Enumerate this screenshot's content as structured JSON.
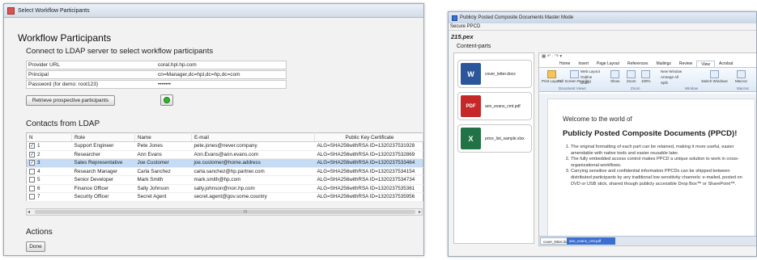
{
  "left_window": {
    "title": "Select Workflow Participants",
    "heading": "Workflow Participants",
    "ldap_subtitle": "Connect to LDAP server to select workflow participants",
    "fields": [
      {
        "label": "Provider URL",
        "value": "coral.hpl.hp.com"
      },
      {
        "label": "Principal",
        "value": "cn=Manager,dc=hpl,dc=hp,dc=com"
      },
      {
        "label": "Password (for demo: root123)",
        "value": "•••••••"
      }
    ],
    "retrieve_button": "Retrieve prospective participants",
    "contacts_heading": "Contacts from LDAP",
    "table": {
      "headers": [
        "N",
        "Role",
        "Name",
        "E-mail",
        "Public Key Certificate"
      ],
      "rows": [
        {
          "checked": true,
          "n": "1",
          "role": "Support Engineer",
          "name": "Pete Jones",
          "email": "pete.jones@never.company",
          "cert": "ALG=SHA256withRSA  ID=1320237531928"
        },
        {
          "checked": true,
          "n": "2",
          "role": "Researcher",
          "name": "Ann Evans",
          "email": "Ann.Evans@ann.evans.com",
          "cert": "ALG=SHA256withRSA  ID=1320237532869"
        },
        {
          "checked": true,
          "n": "3",
          "role": "Sales Representative",
          "name": "Joe Customer",
          "email": "joe.customer@home.address",
          "cert": "ALG=SHA256withRSA  ID=1320237533464",
          "selected": true
        },
        {
          "checked": false,
          "n": "4",
          "role": "Research Manager",
          "name": "Carla Sanchez",
          "email": "carla.sanchez@hp.partner.com",
          "cert": "ALG=SHA256withRSA  ID=1320237534154"
        },
        {
          "checked": false,
          "n": "5",
          "role": "Senior Developer",
          "name": "Mark Smith",
          "email": "mark.smith@hp.com",
          "cert": "ALG=SHA256withRSA  ID=1320237534734"
        },
        {
          "checked": false,
          "n": "6",
          "role": "Finance Officer",
          "name": "Sally Johnson",
          "email": "sally.johnson@non.hp.com",
          "cert": "ALG=SHA256withRSA  ID=1320237535361"
        },
        {
          "checked": false,
          "n": "7",
          "role": "Security Officer",
          "name": "Secret Agent",
          "email": "secret.agent@gov.some.country",
          "cert": "ALG=SHA256withRSA  ID=1320237535956"
        }
      ]
    },
    "scroll_grip": "III",
    "actions_heading": "Actions",
    "done_button": "Done",
    "colors": {
      "selected_row": "#c6dcf5",
      "refresh_icon": "#2fb52f"
    }
  },
  "right_window": {
    "title": "Publicly Posted Composite Documents Master Mode",
    "menu": "Secure PPCD",
    "menu_underline": "S",
    "document_name": "215.pex",
    "content_parts_label": "Content-parts",
    "content_parts": [
      {
        "name": "cover_letter.docx",
        "icon": "word-icon",
        "glyph": "W",
        "color": "#2b579a"
      },
      {
        "name": "ann_evans_cmt.pdf",
        "icon": "pdf-icon",
        "glyph": "PDF",
        "color": "#c62828"
      },
      {
        "name": "price_list_sample.xlsx",
        "icon": "excel-icon",
        "glyph": "X",
        "color": "#217346"
      }
    ],
    "ribbon_tabs": [
      "Home",
      "Insert",
      "Page Layout",
      "References",
      "Mailings",
      "Review",
      "View",
      "Acrobat"
    ],
    "active_tab": "View",
    "ribbon_buttons": {
      "print_layout": "Print Layout",
      "full_screen": "Full Screen Reading",
      "web_layout": "Web Layout",
      "outline": "Outline",
      "draft": "Draft",
      "show": "Show",
      "zoom": "Zoom",
      "zoom_100": "100%",
      "new_window": "New Window",
      "arrange_all": "Arrange All",
      "split": "Split",
      "switch_windows": "Switch Windows",
      "macros": "Macros"
    },
    "ribbon_groups": [
      "Document Views",
      "Zoom",
      "Window",
      "Macros"
    ],
    "document": {
      "welcome": "Welcome to the world of",
      "title": "Publicly Posted Composite Documents (PPCD)!",
      "points": [
        "The original formatting of each part can be retained, making it more useful, easier amendable with native tools and easier reusable later.",
        "The fully embedded access control makes PPCD a unique solution to work in cross-organizational workflows.",
        "Carrying sensitive and confidential information PPCDs can be shipped between distributed participants by any traditional low sensitivity channels: e-mailed, posted on DVD or USB stick, shared though publicly accessible Drop Box™ or SharePoint™."
      ]
    },
    "status_tabs": [
      "cover_letter.docx",
      "ann_evans_cmt.pdf   price_list..."
    ]
  }
}
